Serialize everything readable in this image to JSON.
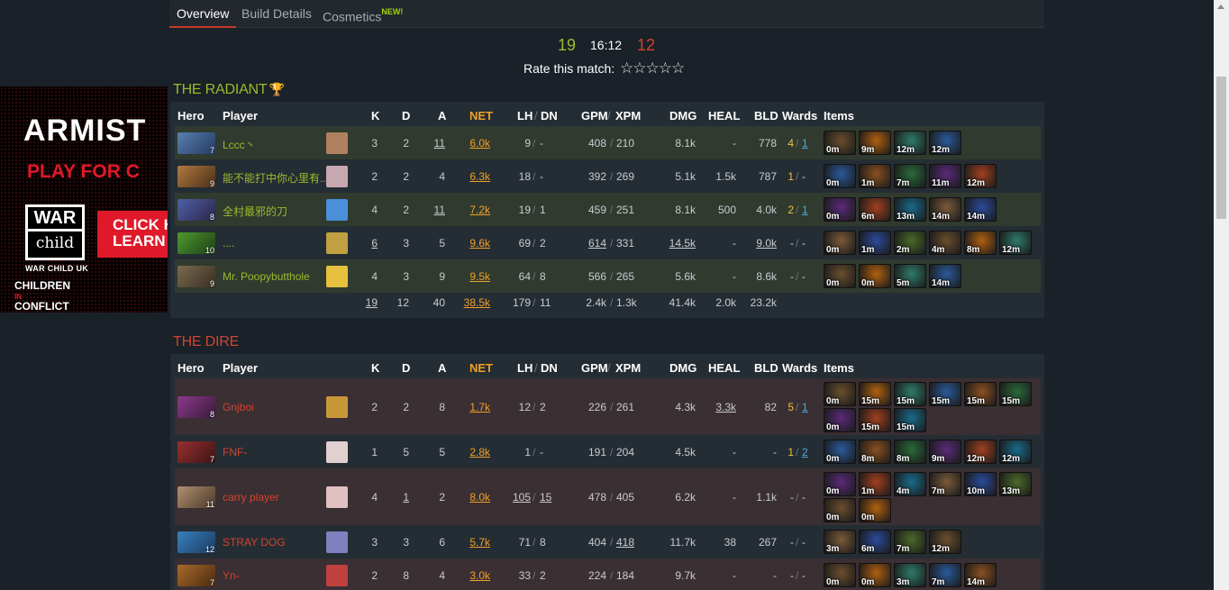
{
  "tabs": [
    {
      "label": "Overview",
      "active": true
    },
    {
      "label": "Build Details",
      "active": false
    },
    {
      "label": "Cosmetics",
      "badge": "NEW!",
      "active": false
    }
  ],
  "score": {
    "radiant": "19",
    "time": "16:12",
    "dire": "12"
  },
  "rate": {
    "label": "Rate this match:",
    "stars": "☆☆☆☆☆"
  },
  "ad": {
    "line1": "ARMIST",
    "line2": "PLAY FOR C",
    "war": "WAR",
    "child": "child",
    "warsub": "WAR CHILD UK",
    "click1": "CLICK H",
    "click2": "LEARN",
    "children1": "CHILDREN",
    "in": "IN",
    "children2": "CONFLICT"
  },
  "columns": {
    "hero": "Hero",
    "player": "Player",
    "k": "K",
    "d": "D",
    "a": "A",
    "net": "NET",
    "lh": "LH",
    "dn": "DN",
    "gpm": "GPM",
    "xpm": "XPM",
    "dmg": "DMG",
    "heal": "HEAL",
    "bld": "BLD",
    "wards": "Wards",
    "items": "Items"
  },
  "radiant": {
    "title": "THE RADIANT",
    "players": [
      {
        "level": "7",
        "name": "Lccc丶",
        "k": "3",
        "d": "2",
        "a": "11",
        "net": "6.0k",
        "lh": "9",
        "dn": "-",
        "gpm": "408",
        "xpm": "210",
        "dmg": "8.1k",
        "heal": "-",
        "bld": "778",
        "wards_obs": "4",
        "wards_sen": "1",
        "items": [
          "0m",
          "9m",
          "12m",
          "12m"
        ]
      },
      {
        "level": "9",
        "name": "能不能打中你心里有...",
        "k": "2",
        "d": "2",
        "a": "4",
        "net": "6.3k",
        "lh": "18",
        "dn": "-",
        "gpm": "392",
        "xpm": "269",
        "dmg": "5.1k",
        "heal": "1.5k",
        "bld": "787",
        "wards_obs": "1",
        "wards_sen": "-",
        "items": [
          "0m",
          "1m",
          "7m",
          "11m",
          "12m"
        ]
      },
      {
        "level": "8",
        "name": "全村最邪的刀",
        "k": "4",
        "d": "2",
        "a": "11",
        "net": "7.2k",
        "lh": "19",
        "dn": "1",
        "gpm": "459",
        "xpm": "251",
        "dmg": "8.1k",
        "heal": "500",
        "bld": "4.0k",
        "wards_obs": "2",
        "wards_sen": "1",
        "items": [
          "0m",
          "6m",
          "13m",
          "14m",
          "14m"
        ]
      },
      {
        "level": "10",
        "name": "....",
        "k": "6",
        "d": "3",
        "a": "5",
        "net": "9.6k",
        "lh": "69",
        "dn": "2",
        "gpm": "614",
        "xpm": "331",
        "dmg": "14.5k",
        "heal": "-",
        "bld": "9.0k",
        "wards_obs": "-",
        "wards_sen": "-",
        "items": [
          "0m",
          "1m",
          "2m",
          "4m",
          "8m",
          "12m"
        ]
      },
      {
        "level": "9",
        "name": "Mr. Poopybutthole",
        "k": "4",
        "d": "3",
        "a": "9",
        "net": "9.5k",
        "lh": "64",
        "dn": "8",
        "gpm": "566",
        "xpm": "265",
        "dmg": "5.6k",
        "heal": "-",
        "bld": "8.6k",
        "wards_obs": "-",
        "wards_sen": "-",
        "items": [
          "0m",
          "0m",
          "5m",
          "14m"
        ]
      }
    ],
    "totals": {
      "k": "19",
      "d": "12",
      "a": "40",
      "net": "38.5k",
      "lh": "179",
      "dn": "11",
      "gpm": "2.4k",
      "xpm": "1.3k",
      "dmg": "41.4k",
      "heal": "2.0k",
      "bld": "23.2k"
    }
  },
  "dire": {
    "title": "THE DIRE",
    "players": [
      {
        "level": "8",
        "name": "Gnjboi",
        "k": "2",
        "d": "2",
        "a": "8",
        "net": "1.7k",
        "lh": "12",
        "dn": "2",
        "gpm": "226",
        "xpm": "261",
        "dmg": "4.3k",
        "heal": "3.3k",
        "bld": "82",
        "wards_obs": "5",
        "wards_sen": "1",
        "items": [
          "0m",
          "15m",
          "15m",
          "15m",
          "15m",
          "15m",
          "0m",
          "15m",
          "15m"
        ]
      },
      {
        "level": "7",
        "name": "FNF-",
        "k": "1",
        "d": "5",
        "a": "5",
        "net": "2.8k",
        "lh": "1",
        "dn": "-",
        "gpm": "191",
        "xpm": "204",
        "dmg": "4.5k",
        "heal": "-",
        "bld": "-",
        "wards_obs": "1",
        "wards_sen": "2",
        "items": [
          "0m",
          "8m",
          "8m",
          "9m",
          "12m",
          "12m"
        ]
      },
      {
        "level": "11",
        "name": "carry player",
        "k": "4",
        "d": "1",
        "a": "2",
        "net": "8.0k",
        "lh": "105",
        "dn": "15",
        "gpm": "478",
        "xpm": "405",
        "dmg": "6.2k",
        "heal": "-",
        "bld": "1.1k",
        "wards_obs": "-",
        "wards_sen": "-",
        "items": [
          "0m",
          "1m",
          "4m",
          "7m",
          "10m",
          "13m",
          "0m",
          "0m"
        ]
      },
      {
        "level": "12",
        "name": "STRAY DOG",
        "k": "3",
        "d": "3",
        "a": "6",
        "net": "5.7k",
        "lh": "71",
        "dn": "8",
        "gpm": "404",
        "xpm": "418",
        "dmg": "11.7k",
        "heal": "38",
        "bld": "267",
        "wards_obs": "-",
        "wards_sen": "-",
        "items": [
          "3m",
          "6m",
          "7m",
          "12m"
        ]
      },
      {
        "level": "7",
        "name": "Yn-",
        "k": "2",
        "d": "8",
        "a": "4",
        "net": "3.0k",
        "lh": "33",
        "dn": "2",
        "gpm": "224",
        "xpm": "184",
        "dmg": "9.7k",
        "heal": "-",
        "bld": "-",
        "wards_obs": "-",
        "wards_sen": "-",
        "items": [
          "0m",
          "0m",
          "3m",
          "7m",
          "14m"
        ]
      }
    ]
  },
  "colors": {
    "radiant": "#9bbb2c",
    "dire": "#d24330",
    "net": "#f0a028",
    "link": "#4aa9d6"
  }
}
